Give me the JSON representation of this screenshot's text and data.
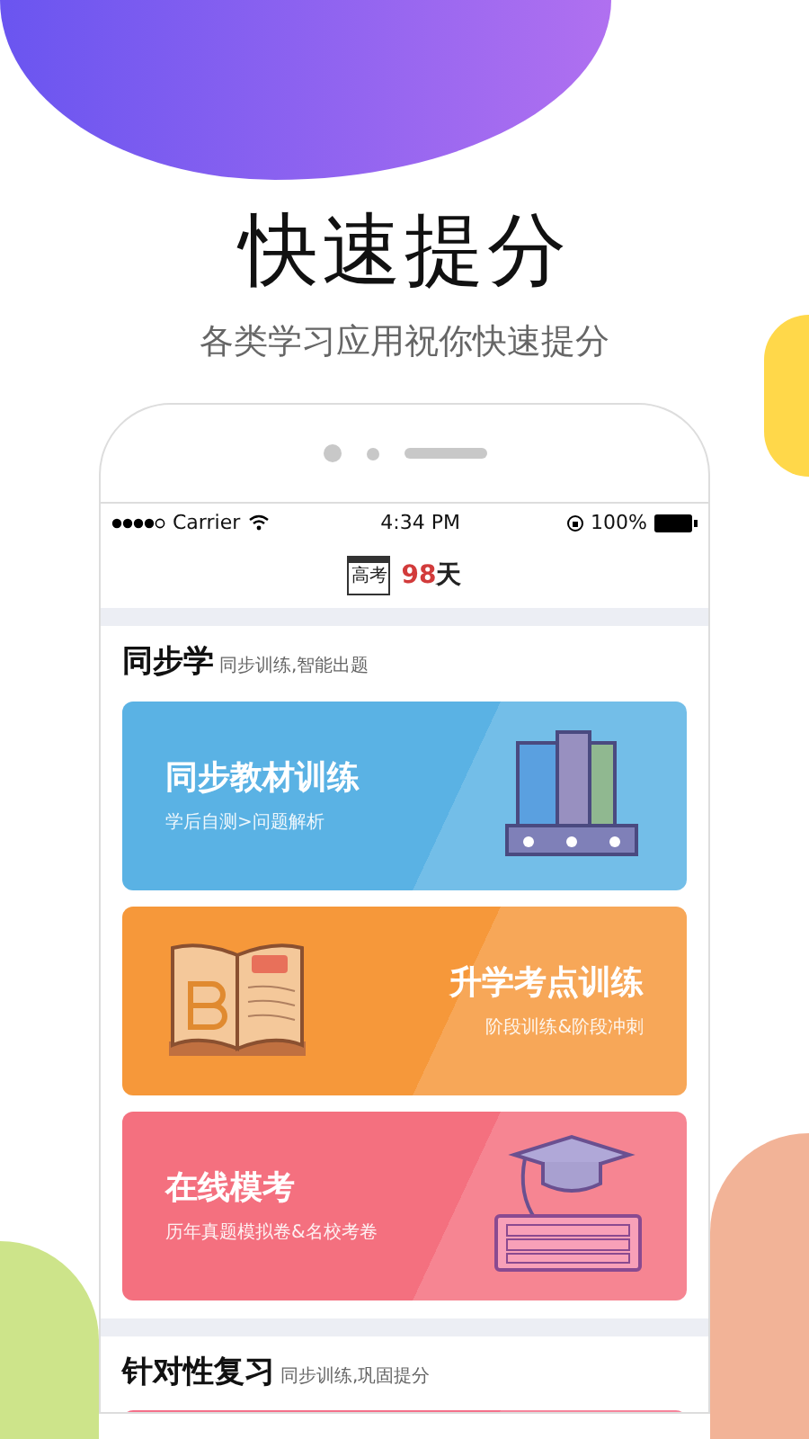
{
  "headline": "快速提分",
  "subtitle": "各类学习应用祝你快速提分",
  "status_bar": {
    "carrier": "Carrier",
    "time": "4:34 PM",
    "battery": "100%"
  },
  "countdown": {
    "icon_label": "高考",
    "number": "98",
    "unit": "天"
  },
  "sections": [
    {
      "title": "同步学",
      "subtitle": "同步训练,智能出题",
      "cards": [
        {
          "kind": "books",
          "title": "同步教材训练",
          "subtitle": "学后自测>问题解析",
          "color": "#5ab2e4"
        },
        {
          "kind": "open-book",
          "title": "升学考点训练",
          "subtitle": "阶段训练&阶段冲刺",
          "color": "#f6983a"
        },
        {
          "kind": "graduation",
          "title": "在线模考",
          "subtitle": "历年真题模拟卷&名校考卷",
          "color": "#f4707f"
        }
      ]
    },
    {
      "title": "针对性复习",
      "subtitle": "同步训练,巩固提分",
      "cards": [
        {
          "kind": "cut",
          "color": "#f4708a"
        }
      ]
    }
  ]
}
